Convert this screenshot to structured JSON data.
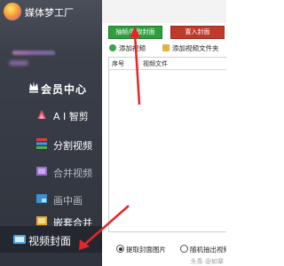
{
  "app": {
    "title": "媒体梦工厂"
  },
  "sidebar": {
    "items": [
      {
        "label": "会员中心",
        "icon": "crown-icon"
      },
      {
        "label": "A I 智剪",
        "icon": "ai-icon"
      },
      {
        "label": "分割视频",
        "icon": "split-icon"
      },
      {
        "label": "合并视频",
        "icon": "merge-icon"
      },
      {
        "label": "画中画",
        "icon": "pip-icon"
      },
      {
        "label": "嵌套合并",
        "icon": "nest-icon"
      },
      {
        "label": "视频封面",
        "icon": "cover-icon"
      }
    ],
    "active_index": 6
  },
  "toolbar": {
    "extract_label": "抽帧/提取封面",
    "set_label": "置入封面",
    "add_video_label": "添加视频",
    "add_folder_label": "添加视频文件夹"
  },
  "table": {
    "columns": [
      "序号",
      "视频文件"
    ],
    "rows": []
  },
  "bottom": {
    "radio_extract_label": "提取封面图片",
    "radio_random_label": "随机抽出视频",
    "selected": "提取封面图片"
  },
  "watermark": "头条 @如翠"
}
